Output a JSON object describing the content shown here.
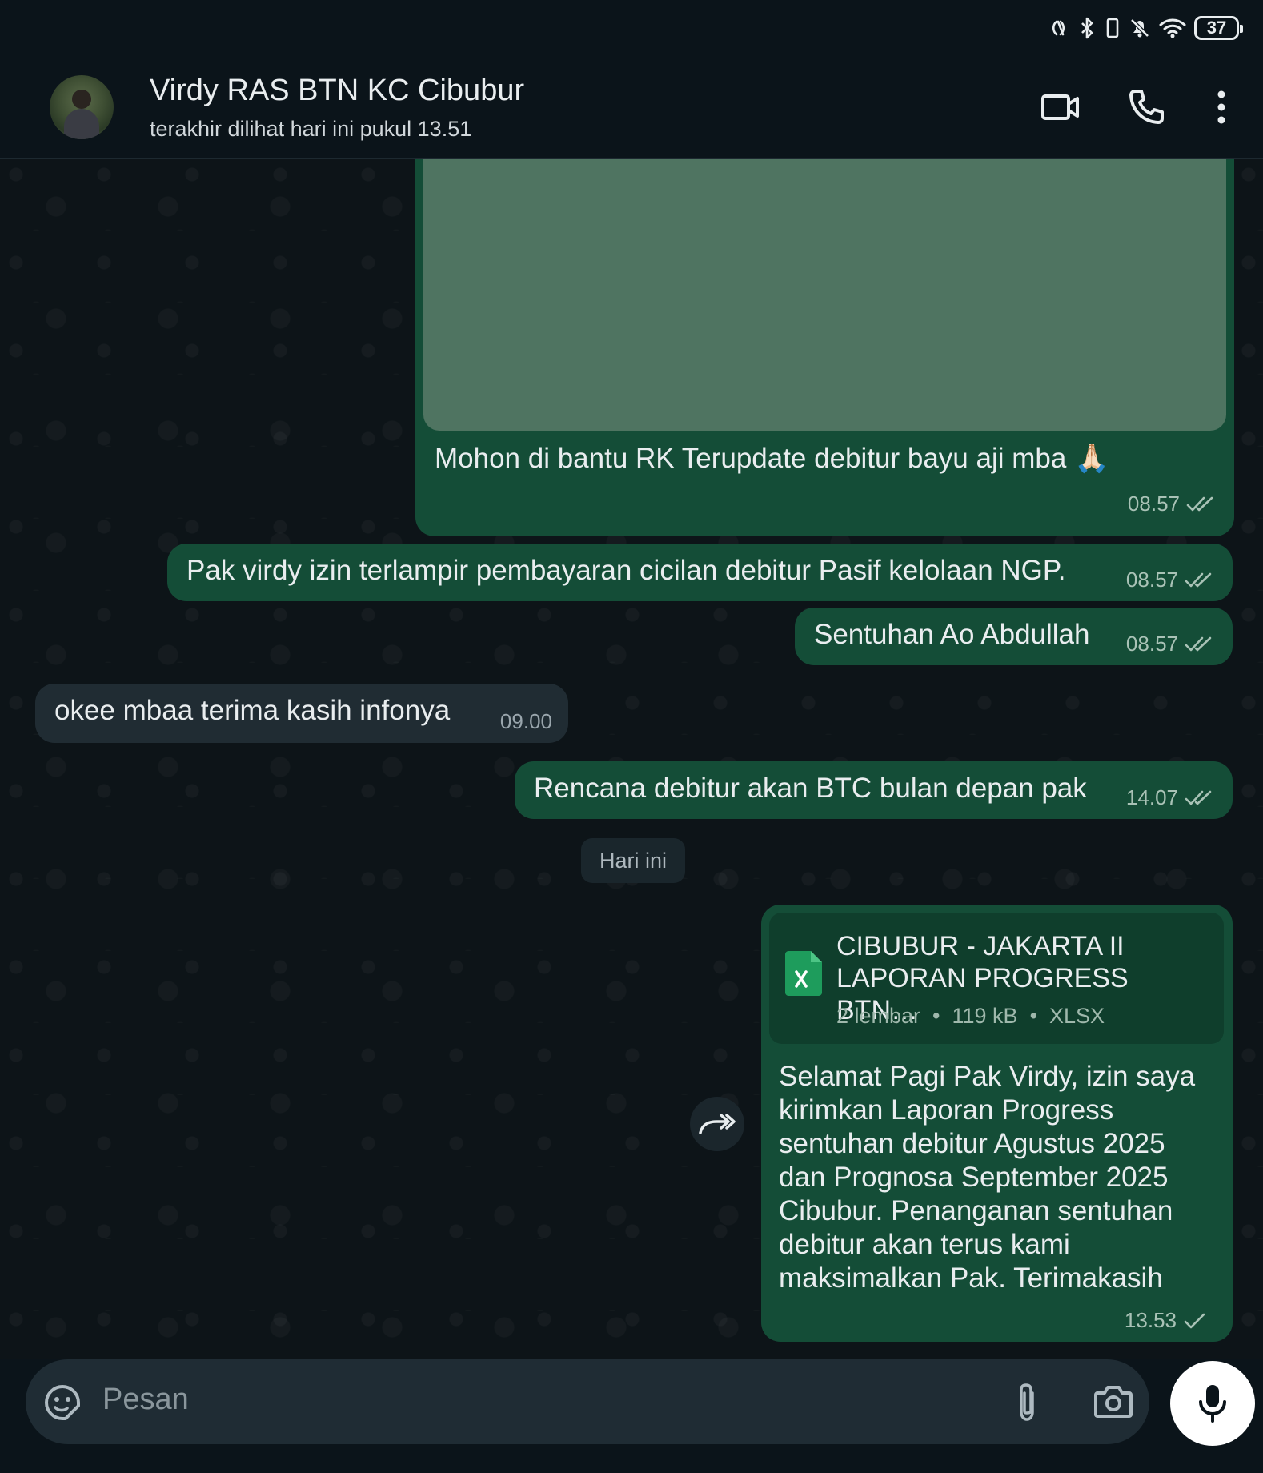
{
  "status_bar": {
    "battery": "37",
    "icons": [
      "nfc-icon",
      "bluetooth-icon",
      "vibrate-icon",
      "mute-icon",
      "wifi-icon",
      "battery-icon"
    ]
  },
  "header": {
    "contact_name": "Virdy RAS BTN KC Cibubur",
    "last_seen": "terakhir dilihat hari ini pukul 13.51",
    "actions": [
      "video-call-icon",
      "voice-call-icon",
      "more-options-icon"
    ]
  },
  "messages": [
    {
      "type": "image",
      "direction": "out",
      "caption": "Mohon di bantu RK Terupdate debitur bayu aji mba 🙏🏻",
      "time": "08.57",
      "status": "read"
    },
    {
      "type": "text",
      "direction": "out",
      "text": "Pak virdy izin terlampir pembayaran cicilan debitur Pasif kelolaan NGP.",
      "time": "08.57",
      "status": "read"
    },
    {
      "type": "text",
      "direction": "out",
      "text": "Sentuhan Ao Abdullah",
      "time": "08.57",
      "status": "read"
    },
    {
      "type": "text",
      "direction": "in",
      "text": "okee mbaa terima kasih infonya",
      "time": "09.00"
    },
    {
      "type": "text",
      "direction": "out",
      "text": "Rencana debitur akan BTC bulan depan pak",
      "time": "14.07",
      "status": "read"
    },
    {
      "type": "document",
      "direction": "out",
      "doc_title_line1": "CIBUBUR - JAKARTA II",
      "doc_title_line2": "LAPORAN PROGRESS BTN…",
      "doc_meta": "2 lembar  •  119 kB  •  XLSX",
      "text": "Selamat Pagi Pak Virdy, izin saya kirimkan Laporan Progress sentuhan debitur Agustus 2025 dan Prognosa September 2025 Cibubur. Penanganan sentuhan debitur akan terus kami maksimalkan Pak. Terimakasih",
      "time": "13.53",
      "status": "sent"
    }
  ],
  "date_divider": "Hari ini",
  "composer": {
    "placeholder": "Pesan"
  },
  "colors": {
    "outgoing_bubble": "#144d37",
    "incoming_bubble": "#202c33",
    "background": "#0b141a",
    "read_tick": "#a9c2b6"
  }
}
